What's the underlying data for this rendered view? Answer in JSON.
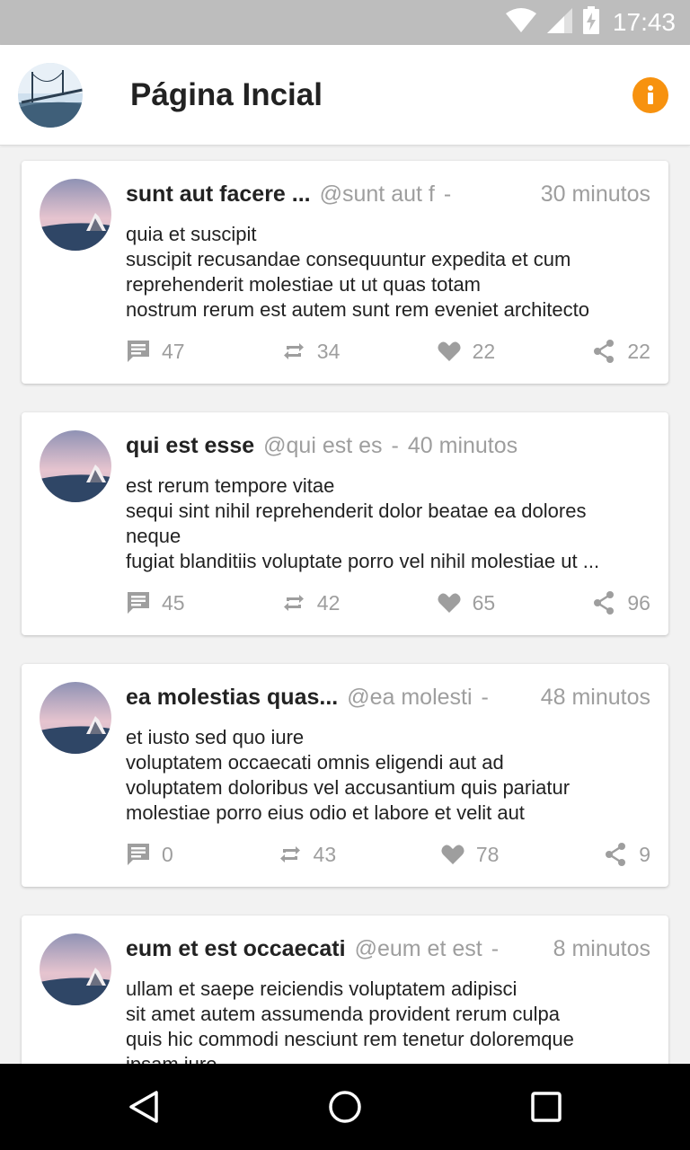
{
  "status_bar": {
    "time": "17:43",
    "icons": [
      "wifi-icon",
      "signal-icon",
      "battery-charging-icon"
    ]
  },
  "app_bar": {
    "title": "Página Incial",
    "avatar_icon": "bridge-photo-avatar",
    "info_icon": "info-icon"
  },
  "colors": {
    "accent": "#f7920f",
    "status_bar": "#bdbdbd",
    "text_secondary": "#9e9e9e"
  },
  "posts": [
    {
      "name": "sunt aut facere ...",
      "handle": "@sunt aut f",
      "separator": "-",
      "time": "30 minutos",
      "body": "quia et suscipit\nsuscipit recusandae consequuntur expedita et cum\nreprehenderit molestiae ut ut quas totam\nnostrum rerum est autem sunt rem eveniet architecto",
      "comments": "47",
      "retweets": "34",
      "likes": "22",
      "shares": "22"
    },
    {
      "name": "qui est esse",
      "handle": "@qui est es",
      "separator": "-",
      "time": "40 minutos",
      "body": "est rerum tempore vitae\nsequi sint nihil reprehenderit dolor beatae ea dolores\nneque\nfugiat blanditiis voluptate porro vel nihil molestiae ut ...",
      "comments": "45",
      "retweets": "42",
      "likes": "65",
      "shares": "96"
    },
    {
      "name": "ea molestias quas...",
      "handle": "@ea molesti",
      "separator": "-",
      "time": "48 minutos",
      "body": "et iusto sed quo iure\nvoluptatem occaecati omnis eligendi aut ad\nvoluptatem doloribus vel accusantium quis pariatur\nmolestiae porro eius odio et labore et velit aut",
      "comments": "0",
      "retweets": "43",
      "likes": "78",
      "shares": "9"
    },
    {
      "name": "eum et est occaecati",
      "handle": "@eum et est",
      "separator": "-",
      "time": "8 minutos",
      "body": "ullam et saepe reiciendis voluptatem adipisci\nsit amet autem assumenda provident rerum culpa\nquis hic commodi nesciunt rem tenetur doloremque\nipsam iure",
      "comments": "",
      "retweets": "",
      "likes": "",
      "shares": ""
    }
  ],
  "nav_bar": {
    "buttons": [
      "back-icon",
      "home-icon",
      "recents-icon"
    ]
  }
}
